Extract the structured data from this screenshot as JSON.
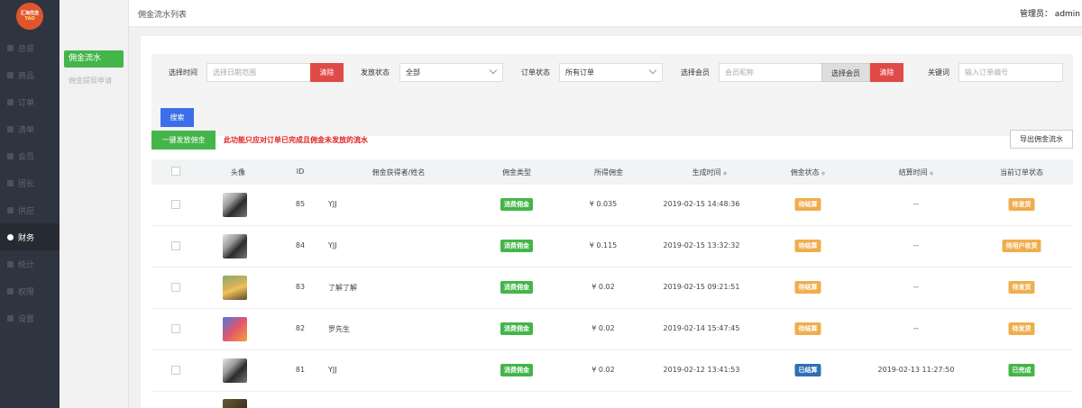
{
  "logo": {
    "line1": "汇淘优选",
    "line2": "TAO"
  },
  "sidebar": {
    "items": [
      {
        "label": "总览",
        "active": false
      },
      {
        "label": "商品",
        "active": false
      },
      {
        "label": "订单",
        "active": false
      },
      {
        "label": "清单",
        "active": false
      },
      {
        "label": "会员",
        "active": false
      },
      {
        "label": "团长",
        "active": false
      },
      {
        "label": "供应",
        "active": false
      },
      {
        "label": "财务",
        "active": true
      },
      {
        "label": "统计",
        "active": false
      },
      {
        "label": "权限",
        "active": false
      },
      {
        "label": "设置",
        "active": false
      }
    ]
  },
  "subnav": {
    "active": "佣金流水",
    "other": "佣金提现申请"
  },
  "header": {
    "page_title": "佣金流水列表",
    "admin": "管理员：  admin"
  },
  "filter": {
    "time_label": "选择时间",
    "time_placeholder": "选择日期范围",
    "clear_label": "清除",
    "status_label": "发放状态",
    "status_value": "全部",
    "order_label": "订单状态",
    "order_value": "所有订单",
    "member_label": "选择会员",
    "member_placeholder": "会员昵称",
    "member_select": "选择会员",
    "keyword_label": "关键词",
    "keyword_placeholder": "输入订单编号",
    "search_label": "搜索"
  },
  "actions": {
    "batch_label": "一键发放佣金",
    "warning": "此功能只应对订单已完成且佣金未发放的流水",
    "export_label": "导出佣金流水"
  },
  "table": {
    "headers": {
      "avatar": "头像",
      "id": "ID",
      "owner": "佣金获得者/姓名",
      "type": "佣金类型",
      "amount": "所得佣金",
      "created": "生成时间",
      "status": "佣金状态",
      "settled": "结算时间",
      "order_status": "当前订单状态"
    },
    "sort_icon": "◆",
    "rows": [
      {
        "id": "85",
        "name": "YJJ",
        "type": "消费佣金",
        "amount": "¥ 0.035",
        "created": "2019-02-15 14:48:36",
        "status": "待结算",
        "status_color": "#f0ad4e",
        "settled": "--",
        "order_status": "待发货",
        "order_color": "#f0ad4e",
        "avatar": "bw"
      },
      {
        "id": "84",
        "name": "YJJ",
        "type": "消费佣金",
        "amount": "¥ 0.115",
        "created": "2019-02-15 13:32:32",
        "status": "待结算",
        "status_color": "#f0ad4e",
        "settled": "--",
        "order_status": "待用户收货",
        "order_color": "#f0ad4e",
        "avatar": "bw"
      },
      {
        "id": "83",
        "name": "了解了解",
        "type": "消费佣金",
        "amount": "¥ 0.02",
        "created": "2019-02-15 09:21:51",
        "status": "待结算",
        "status_color": "#f0ad4e",
        "settled": "--",
        "order_status": "待发货",
        "order_color": "#f0ad4e",
        "avatar": "sunset"
      },
      {
        "id": "82",
        "name": "罗先生",
        "type": "消费佣金",
        "amount": "¥ 0.02",
        "created": "2019-02-14 15:47:45",
        "status": "待结算",
        "status_color": "#f0ad4e",
        "settled": "--",
        "order_status": "待发货",
        "order_color": "#f0ad4e",
        "avatar": "color"
      },
      {
        "id": "81",
        "name": "YJJ",
        "type": "消费佣金",
        "amount": "¥ 0.02",
        "created": "2019-02-12 13:41:53",
        "status": "已结算",
        "status_color": "#2f6fb5",
        "settled": "2019-02-13 11:27:50",
        "order_status": "已完成",
        "order_color": "#44b549",
        "avatar": "bw"
      }
    ]
  },
  "colors": {
    "accent_green": "#44b549",
    "danger": "#e04b47",
    "primary": "#3b6ee8",
    "nav_bg": "#2f3540"
  }
}
